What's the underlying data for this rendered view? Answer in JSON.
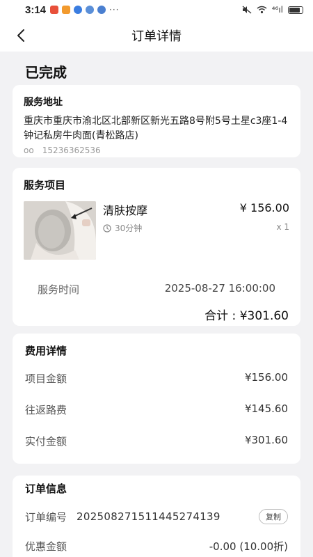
{
  "status_bar": {
    "time": "3:14",
    "more": "···",
    "signal_text": "⁴⁶ıl",
    "battery_level": 0.85
  },
  "nav": {
    "title": "订单详情"
  },
  "order_status": "已完成",
  "address": {
    "title": "服务地址",
    "text": "重庆市重庆市渝北区北部新区新光五路8号附5号土星c3座1-4钟记私房牛肉面(青松路店)",
    "contact_name": "oo",
    "phone": "15236362536"
  },
  "service": {
    "title": "服务项目",
    "item_name": "清肤按摩",
    "price": "¥ 156.00",
    "duration": "30分钟",
    "quantity": "x 1",
    "time_label": "服务时间",
    "time_value": "2025-08-27 16:00:00",
    "total": "合计 : ¥301.60"
  },
  "fees": {
    "title": "费用详情",
    "rows": [
      {
        "label": "项目金额",
        "value": "¥156.00"
      },
      {
        "label": "往返路费",
        "value": "¥145.60"
      },
      {
        "label": "实付金额",
        "value": "¥301.60"
      }
    ]
  },
  "order_info": {
    "title": "订单信息",
    "number_label": "订单编号",
    "number": "20250827151144527413­9",
    "copy_label": "复制",
    "discount_label": "优惠金额",
    "discount_value": "-0.00 (10.00折)"
  }
}
